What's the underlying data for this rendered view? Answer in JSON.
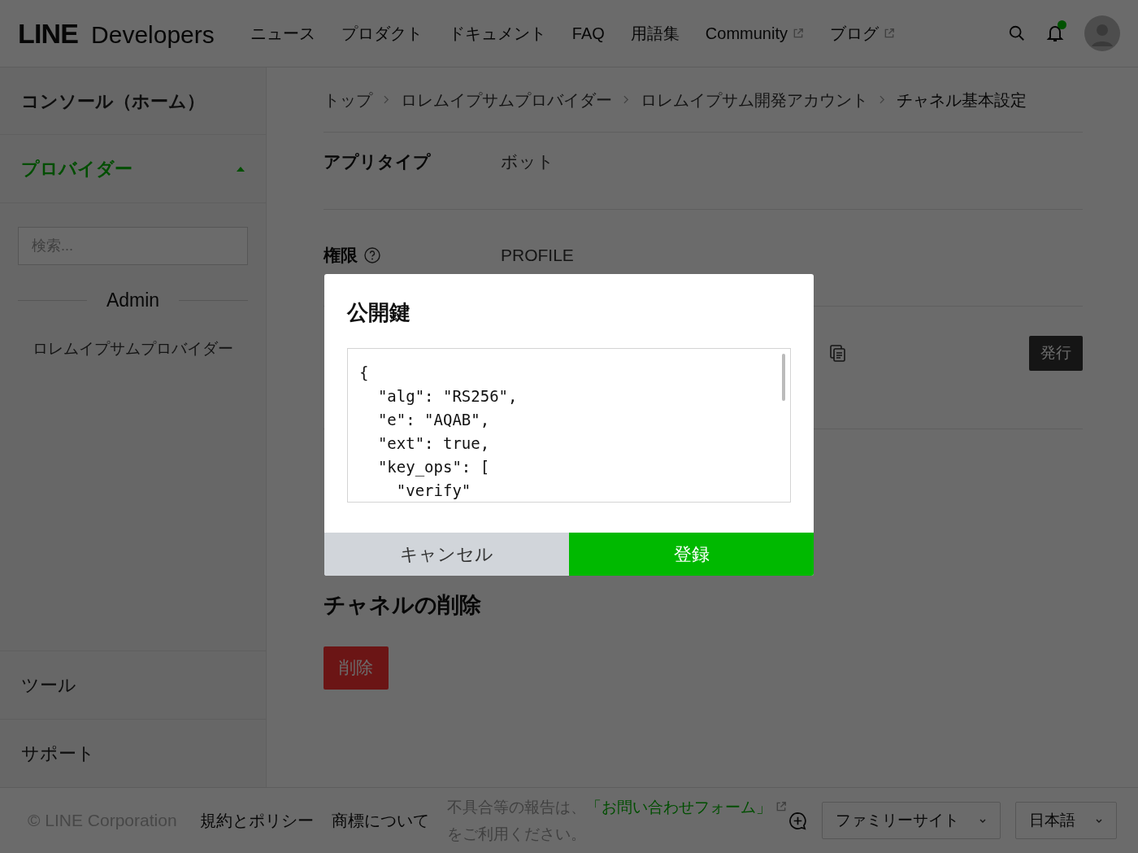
{
  "header": {
    "logo": {
      "brand": "LINE",
      "product": "Developers"
    },
    "nav": [
      {
        "label": "ニュース",
        "external": false
      },
      {
        "label": "プロダクト",
        "external": false
      },
      {
        "label": "ドキュメント",
        "external": false
      },
      {
        "label": "FAQ",
        "external": false
      },
      {
        "label": "用語集",
        "external": false
      },
      {
        "label": "Community",
        "external": true
      },
      {
        "label": "ブログ",
        "external": true
      }
    ],
    "notifications": {
      "unread": true
    }
  },
  "sidebar": {
    "home": "コンソール（ホーム）",
    "provider_section": {
      "label": "プロバイダー",
      "expanded": true,
      "search": {
        "placeholder": "検索..."
      },
      "group": "Admin",
      "items": [
        "ロレムイプサムプロバイダー"
      ]
    },
    "bottom_items": [
      "ツール",
      "サポート"
    ]
  },
  "breadcrumbs": [
    "トップ",
    "ロレムイプサムプロバイダー",
    "ロレムイプサム開発アカウント",
    "チャネル基本設定"
  ],
  "settings": [
    {
      "kind": "text",
      "label": "アプリタイプ",
      "value": "ボット"
    },
    {
      "kind": "text_with_help",
      "label": "権限",
      "value": "PROFILE"
    },
    {
      "kind": "action",
      "button": "発行"
    }
  ],
  "delete_section": {
    "title": "チャネルの削除",
    "button": "削除"
  },
  "modal": {
    "title": "公開鍵",
    "code_lines": [
      "{",
      "  \"alg\": \"RS256\",",
      "  \"e\": \"AQAB\",",
      "  \"ext\": true,",
      "  \"key_ops\": [",
      "    \"verify\""
    ],
    "cancel": "キャンセル",
    "confirm": "登録"
  },
  "footer": {
    "copyright": "© LINE Corporation",
    "links": [
      "規約とポリシー",
      "商標について"
    ],
    "notice": "不具合等の報告は、",
    "notice_link": "「お問い合わせフォーム」",
    "notice_after": "をご利用ください。",
    "selects": [
      "ファミリーサイト",
      "日本語"
    ]
  }
}
